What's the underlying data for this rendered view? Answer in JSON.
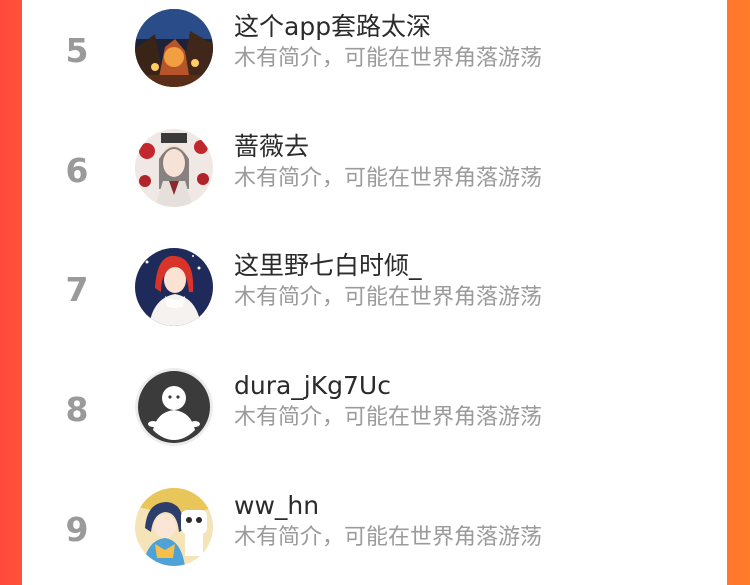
{
  "list": {
    "items": [
      {
        "rank": "5",
        "name": "这个app套路太深",
        "bio": "木有简介，可能在世界角落游荡"
      },
      {
        "rank": "6",
        "name": "蔷薇去",
        "bio": "木有简介，可能在世界角落游荡"
      },
      {
        "rank": "7",
        "name": "这里野七白时倾_",
        "bio": "木有简介，可能在世界角落游荡"
      },
      {
        "rank": "8",
        "name": "dura_jKg7Uc",
        "bio": "木有简介，可能在世界角落游荡"
      },
      {
        "rank": "9",
        "name": "ww_hn",
        "bio": "木有简介，可能在世界角落游荡"
      }
    ]
  }
}
